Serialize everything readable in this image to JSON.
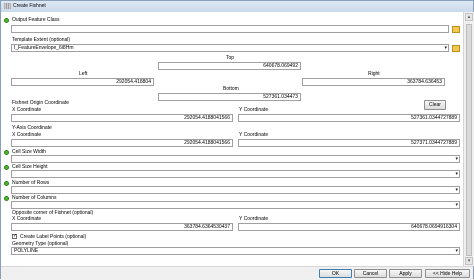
{
  "window": {
    "title": "Create Fishnet"
  },
  "output_feature_class": {
    "label": "Output Feature Class",
    "value": ""
  },
  "template_extent": {
    "label": "Template Extent (optional)",
    "value": "I_FeatureEnvelope_6i8Hm",
    "top_label": "Top",
    "top_value": "640678.069492",
    "left_label": "Left",
    "left_value": "292054.418804",
    "right_label": "Right",
    "right_value": "363784.636453",
    "bottom_label": "Bottom",
    "bottom_value": "527361.034473",
    "clear_label": "Clear"
  },
  "fishnet_origin": {
    "label": "Fishnet Origin Coordinate",
    "x_label": "X Coordinate",
    "x_value": "292054.4188041566",
    "y_label": "Y Coordinate",
    "y_value": "527361.0344727889"
  },
  "y_axis": {
    "label": "Y-Axis Coordinate",
    "x_label": "X Coordinate",
    "x_value": "292054.4188041566",
    "y_label": "Y Coordinate",
    "y_value": "527371.0344727889"
  },
  "cell_size_width": {
    "label": "Cell Size Width",
    "value": ""
  },
  "cell_size_height": {
    "label": "Cell Size Height",
    "value": ""
  },
  "number_of_rows": {
    "label": "Number of Rows",
    "value": ""
  },
  "number_of_columns": {
    "label": "Number of Columns",
    "value": ""
  },
  "opposite_corner": {
    "label": "Opposite corner of Fishnet (optional)",
    "x_label": "X Coordinate",
    "x_value": "363784.6364530437",
    "y_label": "Y Coordinate",
    "y_value": "640678.0694916304"
  },
  "create_label_points": {
    "label": "Create Label Points (optional)",
    "checked": true
  },
  "geometry_type": {
    "label": "Geometry Type (optional)",
    "value": "POLYLINE"
  },
  "buttons": {
    "ok": "OK",
    "cancel": "Cancel",
    "apply": "Apply",
    "hide_help": "<< Hide Help"
  },
  "colors": {
    "required": "#4cbb2c",
    "titlebar": "#c9d9ec"
  }
}
